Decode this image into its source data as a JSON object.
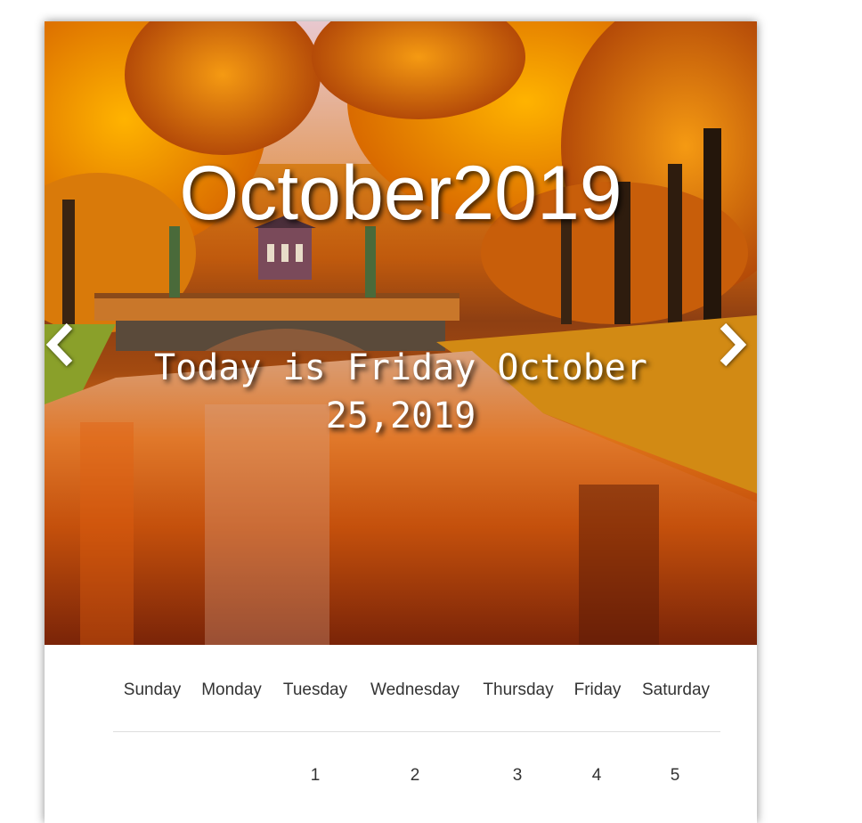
{
  "header": {
    "month": "October",
    "year": "2019",
    "today_text": "Today is Friday October 25,2019"
  },
  "nav": {
    "prev_icon": "chevron-left-icon",
    "next_icon": "chevron-right-icon"
  },
  "weekdays": [
    "Sunday",
    "Monday",
    "Tuesday",
    "Wednesday",
    "Thursday",
    "Friday",
    "Saturday"
  ],
  "first_week": [
    "",
    "",
    "1",
    "2",
    "3",
    "4",
    "5"
  ]
}
